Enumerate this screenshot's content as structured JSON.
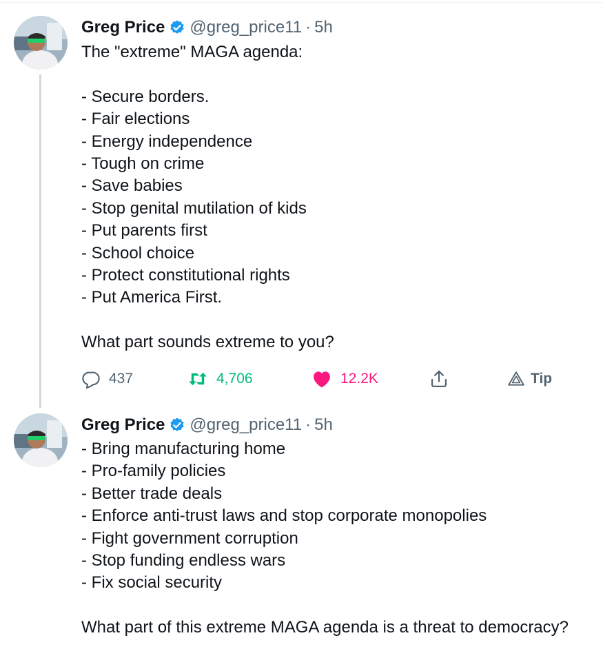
{
  "tweets": [
    {
      "author": {
        "name": "Greg Price",
        "handle": "@greg_price11",
        "time": "5h",
        "verified": true
      },
      "lines": [
        "The \"extreme\" MAGA agenda:",
        "",
        "- Secure borders.",
        "- Fair elections",
        "- Energy independence",
        "- Tough on crime",
        "- Save babies",
        "- Stop genital mutilation of kids",
        "- Put parents first",
        "- School choice",
        "- Protect constitutional rights",
        "- Put America First.",
        "",
        "What part sounds extreme to you?"
      ],
      "actions": {
        "replies": "437",
        "retweets": "4,706",
        "likes": "12.2K",
        "tip_label": "Tip"
      },
      "liked": true
    },
    {
      "author": {
        "name": "Greg Price",
        "handle": "@greg_price11",
        "time": "5h",
        "verified": true
      },
      "lines": [
        "- Bring manufacturing home",
        "- Pro-family policies",
        "- Better trade deals",
        "- Enforce anti-trust laws and stop corporate monopolies",
        "- Fight government corruption",
        "- Stop funding endless wars",
        "- Fix social security",
        "",
        "What part of this extreme MAGA agenda is a threat to democracy?"
      ]
    }
  ],
  "separator": "·",
  "icons": {
    "reply": "reply-icon",
    "retweet": "retweet-icon",
    "like": "heart-icon",
    "share": "share-icon",
    "tip": "tip-icon",
    "verified": "verified-badge-icon"
  },
  "colors": {
    "text": "#0f1419",
    "secondary": "#536471",
    "retweet": "#00ba7c",
    "like": "#f91880",
    "verified": "#1d9bf0",
    "thread_line": "#cfd9de"
  }
}
